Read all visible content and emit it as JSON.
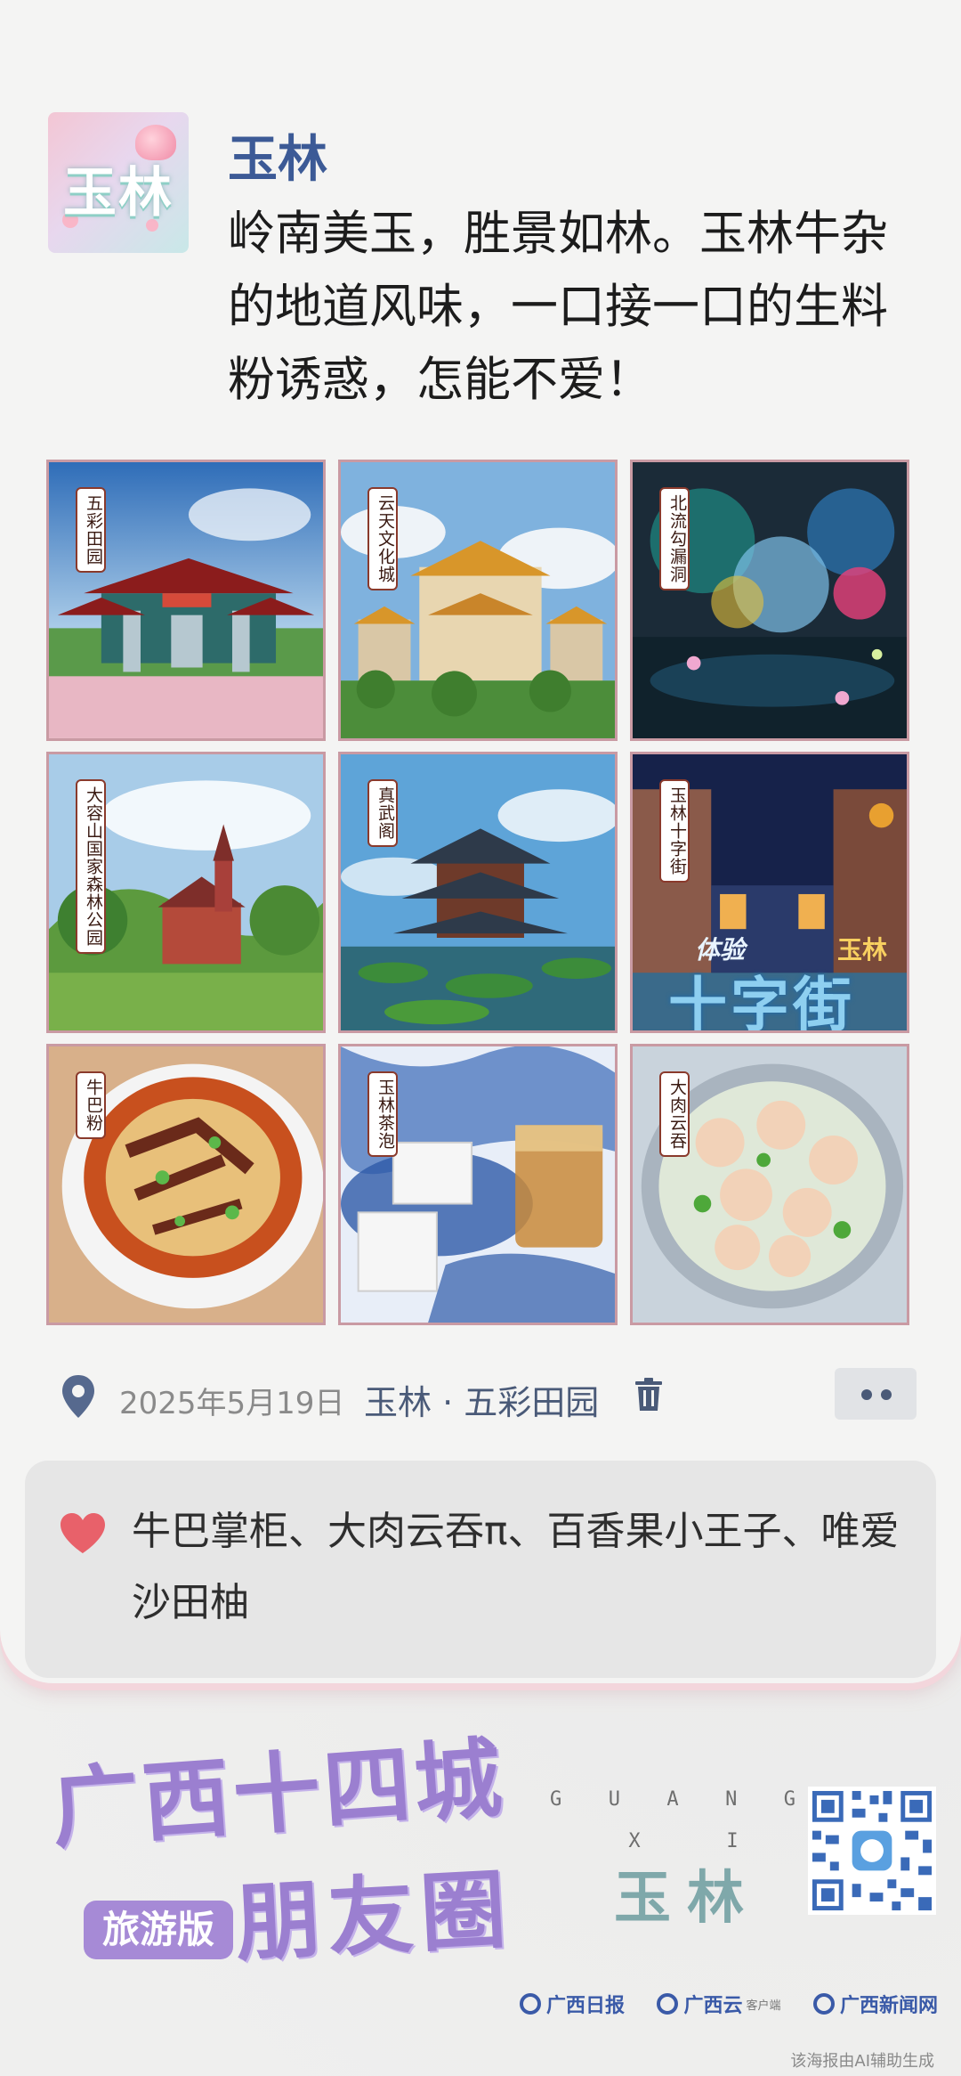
{
  "post": {
    "avatar_text": "玉林",
    "username": "玉林",
    "text": "岭南美玉，胜景如林。玉林牛杂的地道风味，一口接一口的生料粉诱惑，怎能不爱！"
  },
  "tiles": [
    {
      "label": "五彩田园"
    },
    {
      "label": "云天文化城"
    },
    {
      "label": "北流勾漏洞"
    },
    {
      "label": "大容山国家森林公园"
    },
    {
      "label": "真武阁"
    },
    {
      "label": "玉林十字街"
    },
    {
      "label": "牛巴粉"
    },
    {
      "label": "玉林茶泡"
    },
    {
      "label": "大肉云吞"
    }
  ],
  "tile_signs": {
    "crossroad_sign": "十字街",
    "crossroad_top_left": "体验",
    "crossroad_top_right": "玉林"
  },
  "meta": {
    "date": "2025年5月19日",
    "location": "玉林 · 五彩田园"
  },
  "likes": {
    "text": "牛巴掌柜、大肉云吞π、百香果小王子、唯爱沙田柚"
  },
  "brand": {
    "title": "广西十四城",
    "subtitle": "朋友圈",
    "edition": "旅游版",
    "letters_row1": [
      "G",
      "U",
      "A",
      "N",
      "G"
    ],
    "letters_row2": [
      "X",
      "I"
    ],
    "city": "玉林",
    "logo1": "广西日报",
    "logo2": "广西云",
    "logo2_sub": "客户端",
    "logo3": "广西新闻网",
    "ai_note": "该海报由AI辅助生成"
  },
  "colors": {
    "username": "#3c5a96",
    "brand_purple": "#9b7fd0",
    "heart": "#e8616a",
    "city_teal": "#7fa8aa"
  },
  "icons": [
    "location-pin-icon",
    "trash-icon",
    "more-icon",
    "heart-icon",
    "qr-code"
  ]
}
